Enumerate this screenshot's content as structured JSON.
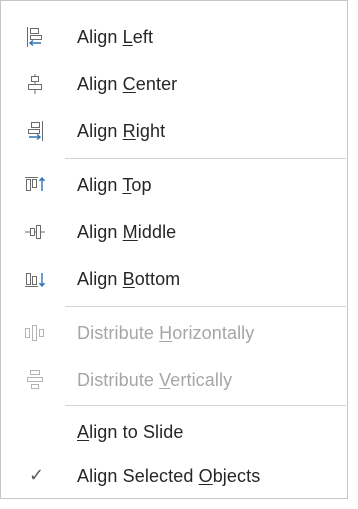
{
  "menu": {
    "align_left": {
      "pre": "Align ",
      "key": "L",
      "post": "eft",
      "icon": "align-left-icon"
    },
    "align_center": {
      "pre": "Align ",
      "key": "C",
      "post": "enter",
      "icon": "align-center-icon"
    },
    "align_right": {
      "pre": "Align ",
      "key": "R",
      "post": "ight",
      "icon": "align-right-icon"
    },
    "align_top": {
      "pre": "Align ",
      "key": "T",
      "post": "op",
      "icon": "align-top-icon"
    },
    "align_middle": {
      "pre": "Align ",
      "key": "M",
      "post": "iddle",
      "icon": "align-middle-icon"
    },
    "align_bottom": {
      "pre": "Align ",
      "key": "B",
      "post": "ottom",
      "icon": "align-bottom-icon"
    },
    "distribute_h": {
      "pre": "Distribute ",
      "key": "H",
      "post": "orizontally",
      "icon": "distribute-horizontally-icon",
      "disabled": true
    },
    "distribute_v": {
      "pre": "Distribute ",
      "key": "V",
      "post": "ertically",
      "icon": "distribute-vertically-icon",
      "disabled": true
    },
    "align_to_slide": {
      "pre": "",
      "key": "A",
      "post": "lign to Slide"
    },
    "align_selected": {
      "pre": "Align Selected ",
      "key": "O",
      "post": "bjects",
      "checked": true,
      "check_glyph": "✓"
    }
  },
  "colors": {
    "icon_blue": "#2e75b6",
    "icon_gray": "#6b6b6b",
    "text": "#262626",
    "disabled_text": "#a6a6a6"
  }
}
